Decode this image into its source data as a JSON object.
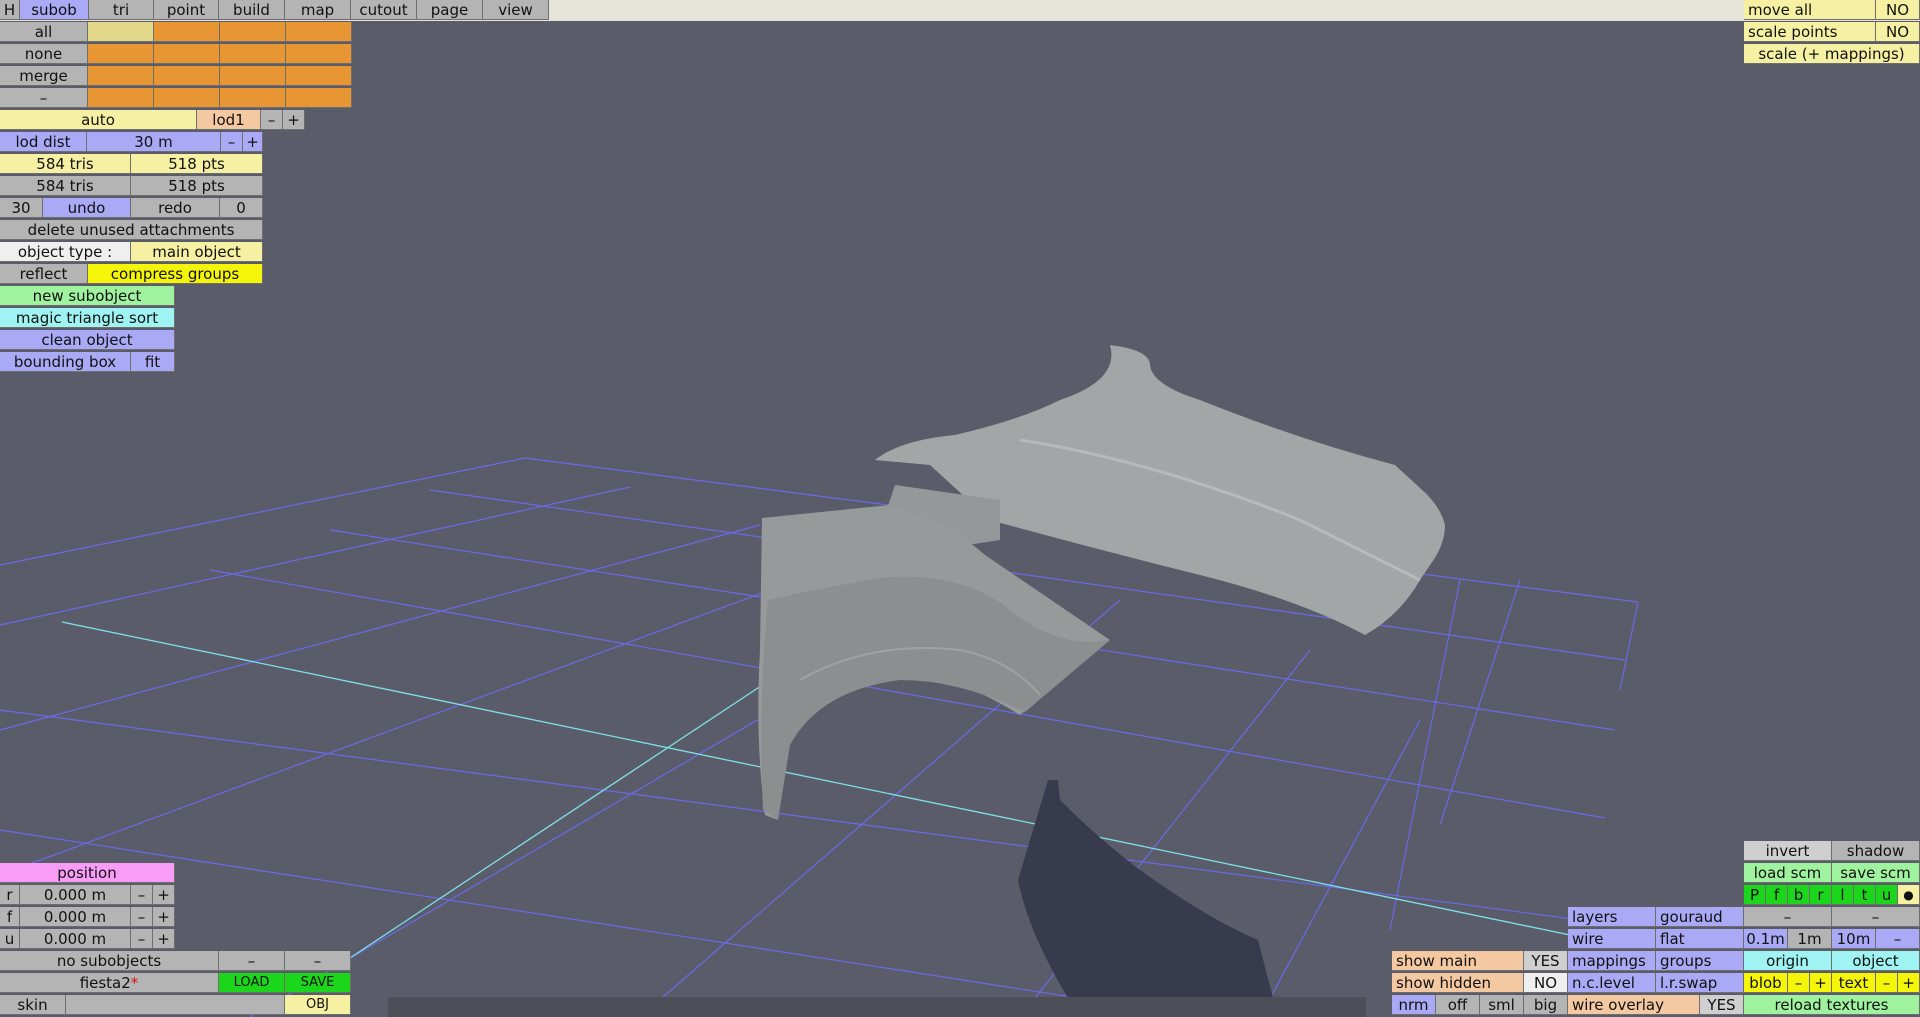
{
  "menu": {
    "h": "H",
    "tabs": [
      "subob",
      "tri",
      "point",
      "build",
      "map",
      "cutout",
      "page",
      "view"
    ]
  },
  "select": {
    "all": "all",
    "none": "none",
    "merge": "merge",
    "minus": "–"
  },
  "lod": {
    "auto": "auto",
    "lod_name": "lod1",
    "minus": "–",
    "plus": "+",
    "dist_label": "lod dist",
    "dist_value": "30 m"
  },
  "stats": {
    "tris1": "584 tris",
    "pts1": "518 pts",
    "tris2": "584 tris",
    "pts2": "518 pts"
  },
  "history": {
    "undo_count": "30",
    "undo": "undo",
    "redo": "redo",
    "redo_count": "0"
  },
  "tools": {
    "delete_unused": "delete unused attachments",
    "object_type_label": "object type :",
    "object_type_value": "main object",
    "reflect": "reflect",
    "compress": "compress groups",
    "new_subobject": "new subobject",
    "magic_sort": "magic triangle sort",
    "clean_object": "clean object",
    "bounding_box": "bounding box",
    "fit": "fit"
  },
  "top_right": {
    "move_all": "move all",
    "move_all_val": "NO",
    "scale_points": "scale points",
    "scale_points_val": "NO",
    "scale_mappings": "scale (+ mappings)"
  },
  "position": {
    "title": "position",
    "r_label": "r",
    "r_value": "0.000 m",
    "f_label": "f",
    "f_value": "0.000 m",
    "u_label": "u",
    "u_value": "0.000 m",
    "minus": "–",
    "plus": "+"
  },
  "file": {
    "no_subobjects": "no subobjects",
    "minus": "–",
    "name": "fiesta2",
    "modified_mark": "*",
    "load": "LOAD",
    "save": "SAVE",
    "skin": "skin",
    "obj": "OBJ"
  },
  "display": {
    "show_main": "show main",
    "show_main_val": "YES",
    "show_hidden": "show hidden",
    "show_hidden_val": "NO",
    "nrm": "nrm",
    "off": "off",
    "sml": "sml",
    "big": "big",
    "layers": "layers",
    "gouraud": "gouraud",
    "wire": "wire",
    "flat": "flat",
    "mappings": "mappings",
    "groups": "groups",
    "nclevel": "n.c.level",
    "lrswap": "l.r.swap",
    "wire_overlay": "wire overlay",
    "wire_overlay_val": "YES"
  },
  "bottom_right": {
    "invert": "invert",
    "shadow": "shadow",
    "load_scm": "load scm",
    "save_scm": "save scm",
    "views": [
      "P",
      "f",
      "b",
      "r",
      "l",
      "t",
      "u"
    ],
    "dot": "●",
    "minus": "–",
    "grid_01": "0.1m",
    "grid_1": "1m",
    "grid_10": "10m",
    "origin": "origin",
    "object": "object",
    "blob": "blob",
    "text": "text",
    "plus": "+",
    "reload": "reload textures"
  },
  "colors": {
    "background": "#5a5c6a",
    "grid": "#6a6ae8",
    "axis": "#7fe0e6",
    "mesh": "#a3a6a6"
  }
}
